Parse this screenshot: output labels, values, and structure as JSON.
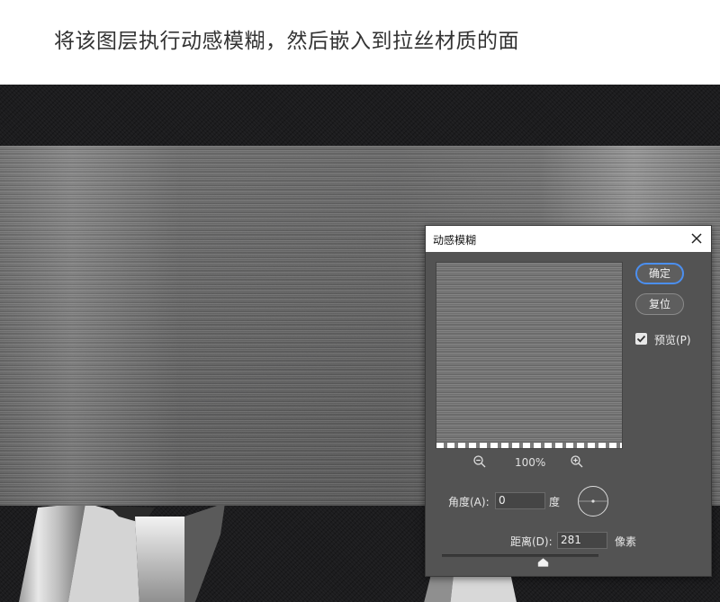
{
  "caption": "将该图层执行动感模糊，然后嵌入到拉丝材质的面",
  "dialog": {
    "title": "动感模糊",
    "ok_label": "确定",
    "reset_label": "复位",
    "preview_label": "预览(P)",
    "preview_checked": true,
    "zoom": "100%",
    "angle_label": "角度(A):",
    "angle_value": "0",
    "angle_unit": "度",
    "distance_label": "距离(D):",
    "distance_value": "281",
    "distance_unit": "像素"
  },
  "icons": {
    "close": "close-icon",
    "zoom_out": "zoom-out-icon",
    "zoom_in": "zoom-in-icon",
    "checkbox": "checkmark-icon",
    "angle_dial": "angle-dial-icon",
    "slider": "slider-thumb-icon"
  }
}
